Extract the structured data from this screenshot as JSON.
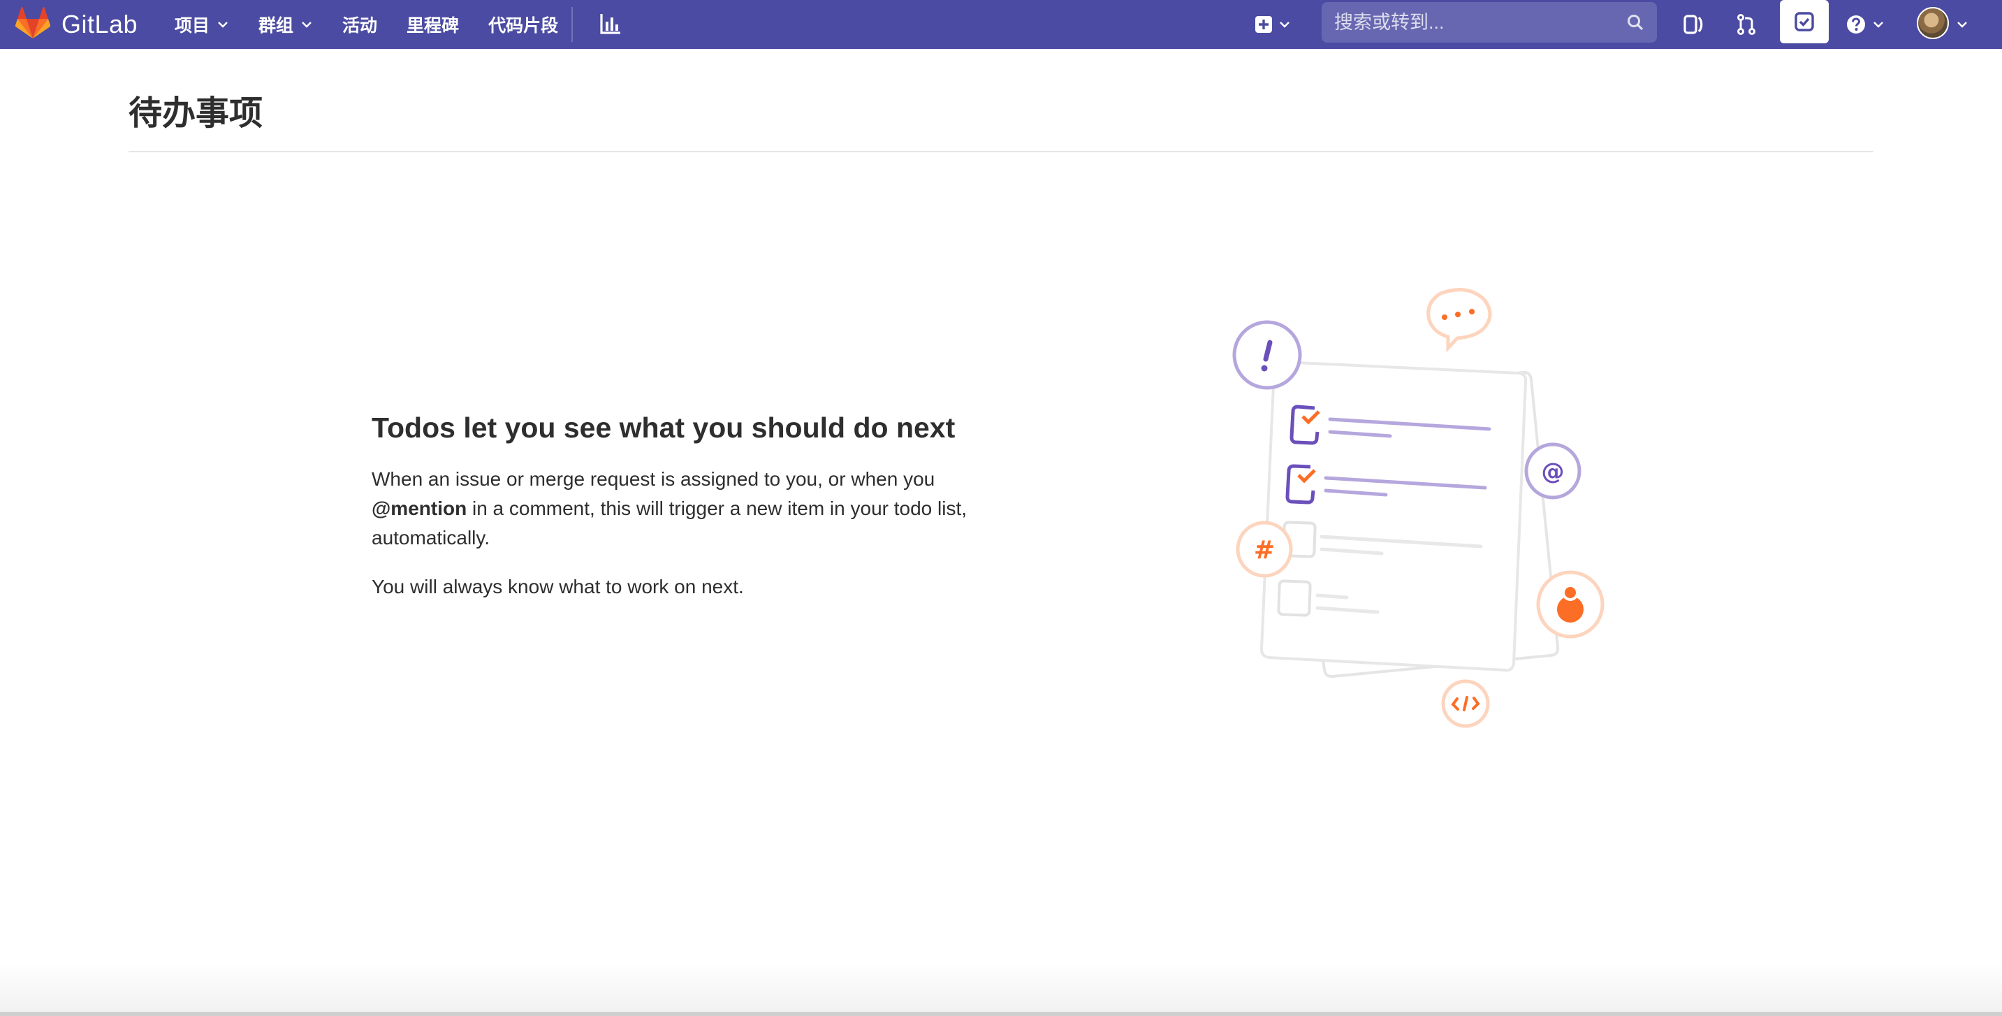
{
  "navbar": {
    "brand_name": "GitLab",
    "background": "#4b4ba3",
    "links": [
      {
        "label": "项目",
        "has_dropdown": true
      },
      {
        "label": "群组",
        "has_dropdown": true
      },
      {
        "label": "活动",
        "has_dropdown": false
      },
      {
        "label": "里程碑",
        "has_dropdown": false
      },
      {
        "label": "代码片段",
        "has_dropdown": false
      }
    ],
    "search": {
      "placeholder": "搜索或转到..."
    },
    "icons": [
      "chart-icon",
      "plus-square-icon",
      "search-icon",
      "issues-icon",
      "merge-request-icon",
      "todo-icon",
      "help-icon",
      "avatar"
    ]
  },
  "page": {
    "title": "待办事项"
  },
  "empty_state": {
    "heading": "Todos let you see what you should do next",
    "p1_before": "When an issue or merge request is assigned to you, or when you ",
    "p1_bold": "@mention",
    "p1_after": " in a comment, this will trigger a new item in your todo list, automatically.",
    "p2": "You will always know what to work on next."
  },
  "colors": {
    "accent_purple": "#6b4fbb",
    "accent_orange": "#fc6d26",
    "light_purple": "#b5a7dd",
    "light_orange": "#fdd4bd"
  }
}
